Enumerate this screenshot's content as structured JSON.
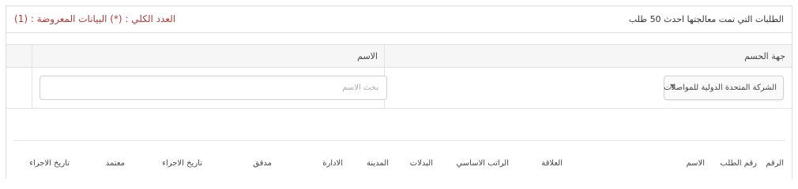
{
  "panel": {
    "title": "الطلبات التي تمت معالجتها احدث 50 طلب",
    "count_text": "العدد الكلي : (*) البيانات المعروضة : (1)"
  },
  "filters": {
    "company_label": "جهة الحسم",
    "name_label": "الاسم",
    "company_selected": "الشركة المتحدة الدولية للمواصلات",
    "name_placeholder": "بحث الاسم"
  },
  "table": {
    "columns": [
      "الرقم",
      "رقم الطلب",
      "الاسم",
      "العلاقة",
      "الراتب الاساسي",
      "البدلات",
      "المدينة",
      "الادارة",
      "مدقق",
      "تاريخ الاجراء",
      "معتمد",
      "تاريخ الاجراء"
    ]
  },
  "colors": {
    "count_text": "#b03a3a",
    "border": "#dcdcdc"
  }
}
